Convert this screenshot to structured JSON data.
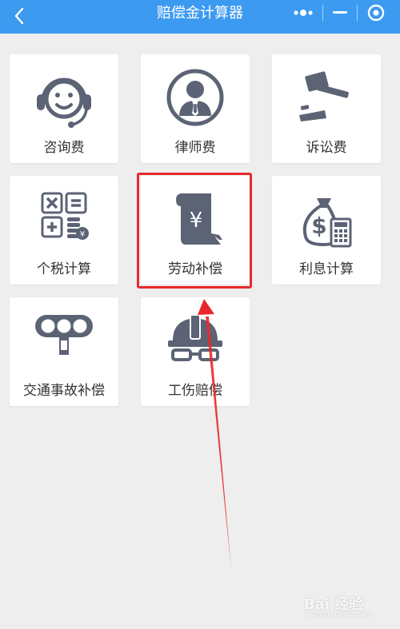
{
  "header": {
    "title": "赔偿金计算器",
    "back_icon": "chevron-left-icon",
    "more_icon": "more-dots-icon",
    "minimize_icon": "minimize-icon",
    "close_icon": "target-circle-icon",
    "bar_color": "#3c9af1"
  },
  "tiles": [
    {
      "label": "咨询费",
      "icon": "headset-icon"
    },
    {
      "label": "律师费",
      "icon": "lawyer-avatar-icon"
    },
    {
      "label": "诉讼费",
      "icon": "gavel-icon"
    },
    {
      "label": "个税计算",
      "icon": "calculator-coins-icon"
    },
    {
      "label": "劳动补偿",
      "icon": "yen-scroll-icon"
    },
    {
      "label": "利息计算",
      "icon": "money-bag-calculator-icon"
    },
    {
      "label": "交通事故补偿",
      "icon": "traffic-light-icon"
    },
    {
      "label": "工伤赔偿",
      "icon": "hard-hat-icon"
    }
  ],
  "annotation": {
    "highlight_color": "#e8292c",
    "highlighted_tile": "劳动补偿"
  },
  "watermark": {
    "text": "Bai 经验",
    "sub": "jingyan.baidu.com"
  },
  "colors": {
    "icon": "#5b6375",
    "background": "#eeeeee"
  }
}
